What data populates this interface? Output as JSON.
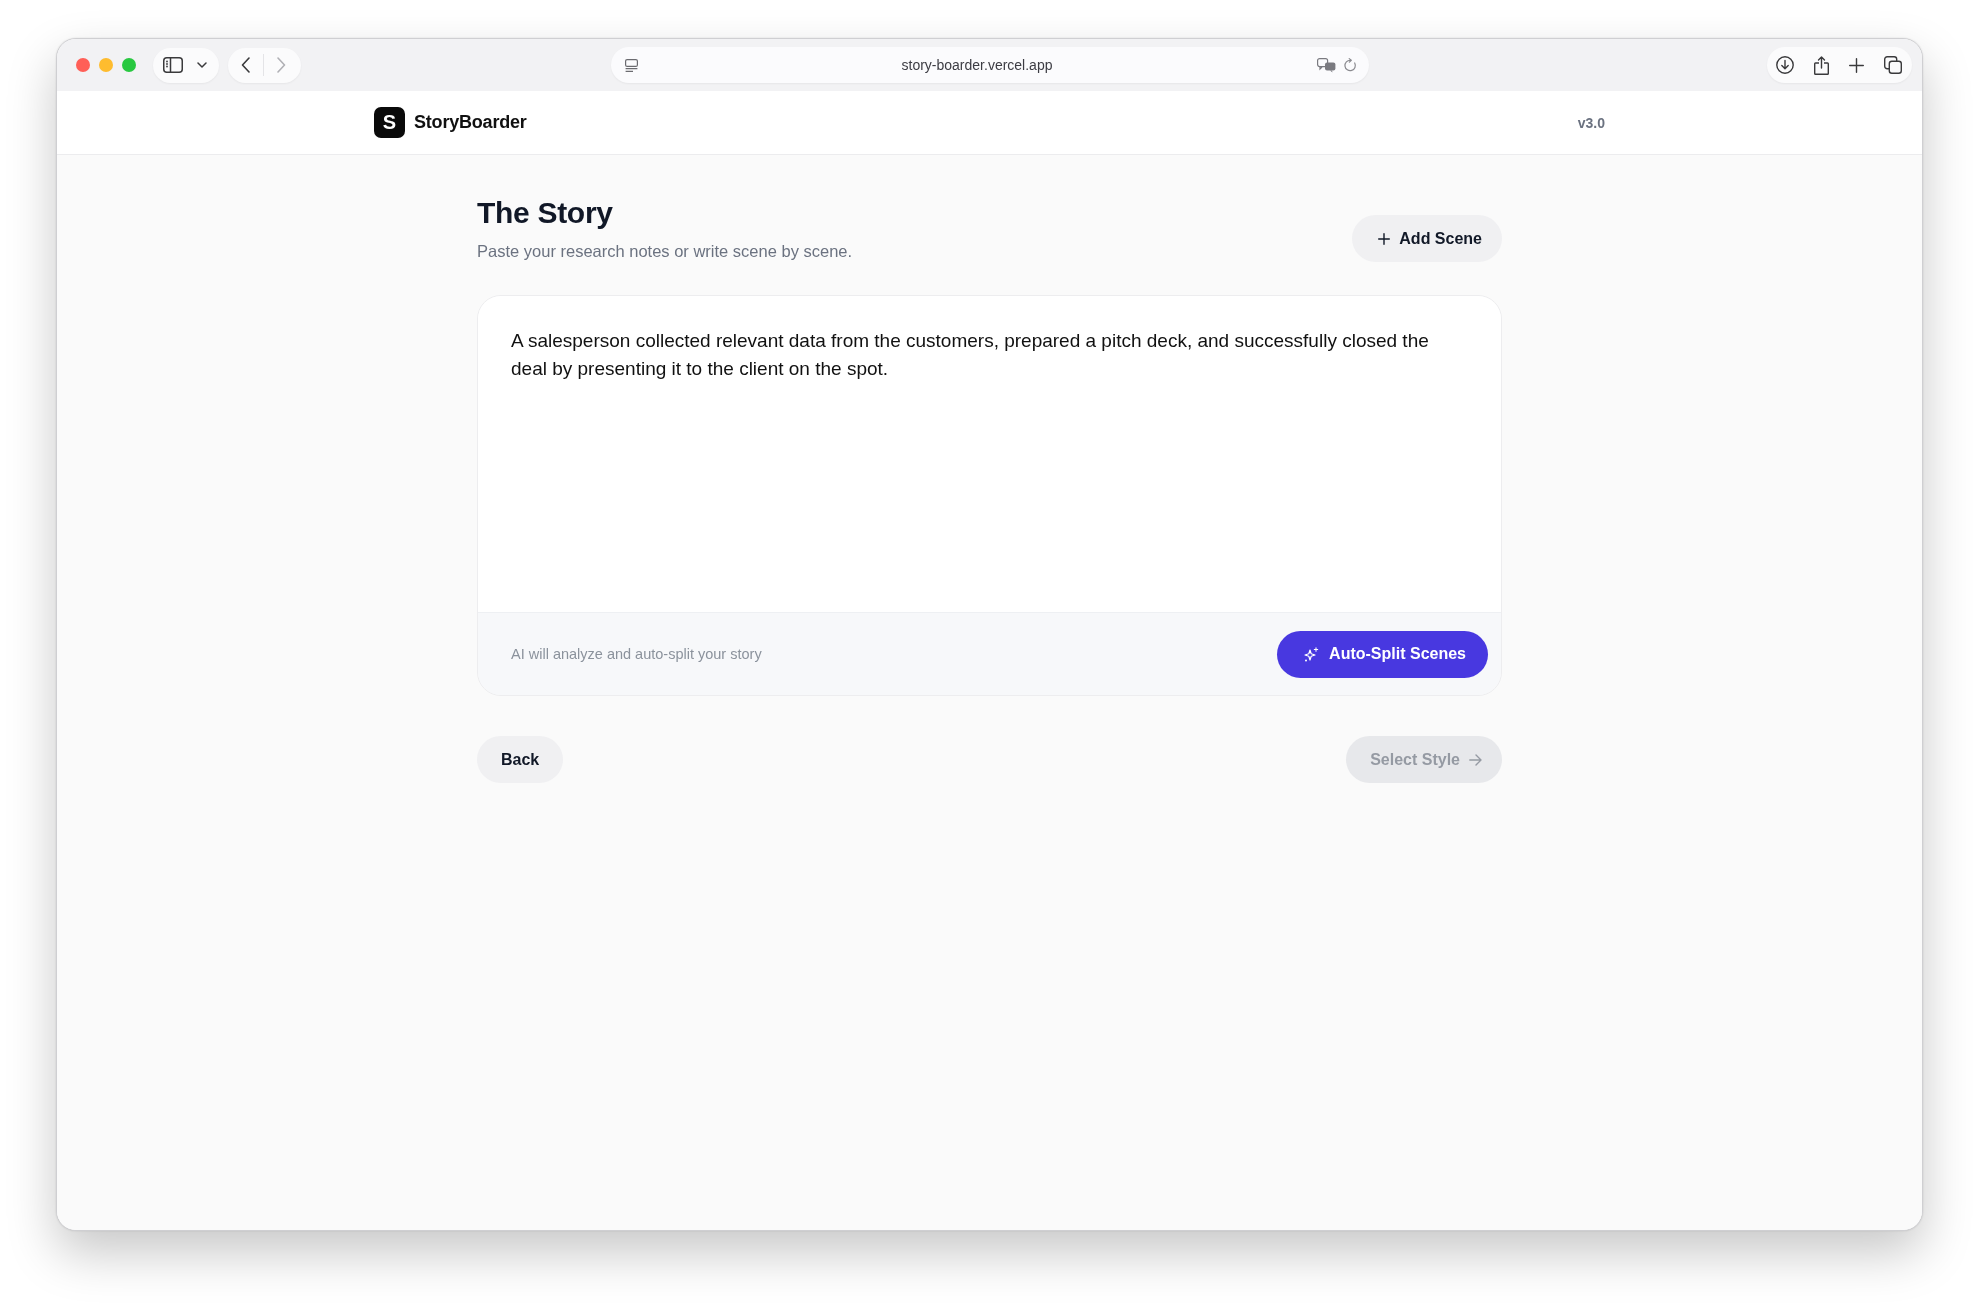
{
  "browser": {
    "url": "story-boarder.vercel.app",
    "nav_buttons": [
      {
        "kind": "back",
        "disabled": false
      },
      {
        "kind": "forward",
        "disabled": true
      }
    ]
  },
  "header": {
    "logo_mark": "S",
    "brand": "StoryBoarder",
    "version": "v3.0"
  },
  "story": {
    "title": "The Story",
    "subtitle": "Paste your research notes or write scene by scene.",
    "add_button": "Add Scene",
    "editor": {
      "value": "A salesperson collected relevant data from the customers, prepared a pitch deck, and successfully closed the deal by presenting it to the client on the spot."
    },
    "hint": "AI will analyze and auto-split your story",
    "split_button": "Auto-Split Scenes"
  },
  "nav": [
    {
      "label": "Back",
      "kind": "back",
      "disabled": false
    },
    {
      "label": "Select Style",
      "kind": "next",
      "disabled": true
    }
  ]
}
